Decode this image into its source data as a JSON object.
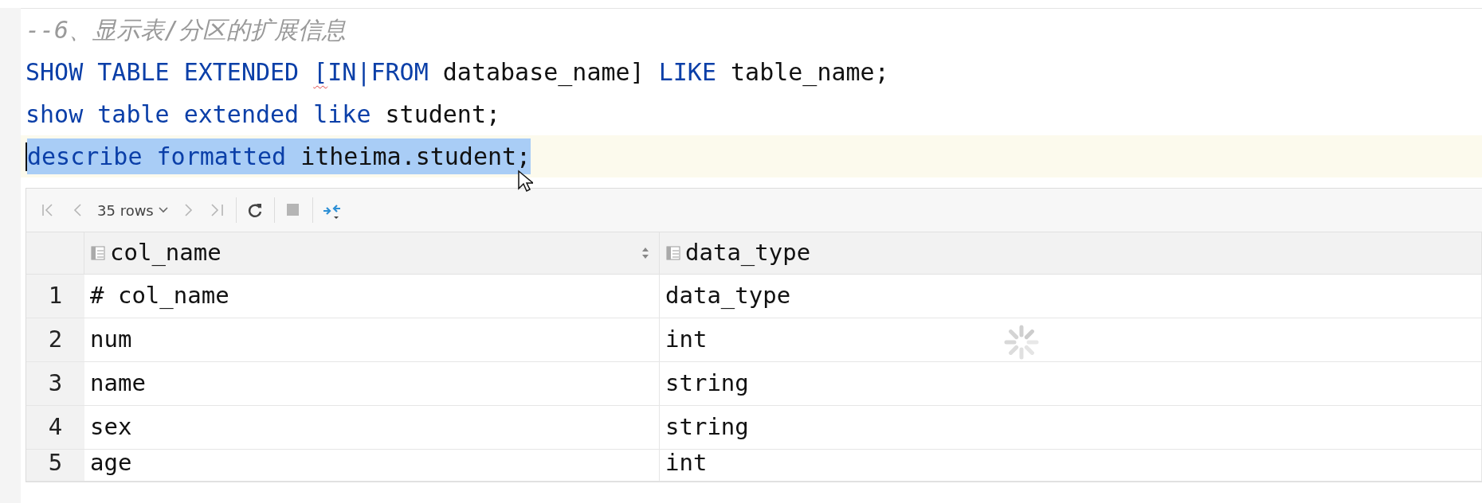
{
  "editor": {
    "lines": [
      {
        "selected": false,
        "caret": false,
        "tokens": [
          {
            "kind": "comment",
            "text": "--6、显示表/分区的扩展信息",
            "error": false
          }
        ]
      },
      {
        "selected": false,
        "caret": false,
        "tokens": [
          {
            "kind": "keyword",
            "text": "SHOW TABLE EXTENDED ",
            "error": false
          },
          {
            "kind": "keyword",
            "text": "[",
            "error": true
          },
          {
            "kind": "keyword",
            "text": "IN|FROM ",
            "error": false
          },
          {
            "kind": "plain",
            "text": "database_name] ",
            "error": false
          },
          {
            "kind": "keyword",
            "text": "LIKE ",
            "error": false
          },
          {
            "kind": "plain",
            "text": "table_name;",
            "error": false
          }
        ]
      },
      {
        "selected": false,
        "caret": false,
        "tokens": [
          {
            "kind": "keyword",
            "text": "show table extended like ",
            "error": false
          },
          {
            "kind": "plain",
            "text": "student;",
            "error": false
          }
        ]
      },
      {
        "selected": true,
        "caret": true,
        "tokens": [
          {
            "kind": "keyword",
            "text": "describe formatted ",
            "error": false
          },
          {
            "kind": "plain",
            "text": "itheima.student;",
            "error": false
          }
        ]
      }
    ]
  },
  "toolbar": {
    "buttons": [
      {
        "kind": "first",
        "disabled": true
      },
      {
        "kind": "prev",
        "disabled": true
      },
      {
        "kind": "rows",
        "text": "35 rows",
        "disabled": false
      },
      {
        "kind": "next",
        "disabled": true
      },
      {
        "kind": "last",
        "disabled": true
      },
      {
        "kind": "separator"
      },
      {
        "kind": "refresh",
        "disabled": false
      },
      {
        "kind": "separator"
      },
      {
        "kind": "stop",
        "disabled": true
      },
      {
        "kind": "separator"
      },
      {
        "kind": "compare",
        "disabled": false
      }
    ]
  },
  "grid": {
    "columns": [
      "col_name",
      "data_type"
    ],
    "loading": true,
    "rows": [
      {
        "number": "1",
        "cells": [
          "# col_name",
          "data_type"
        ]
      },
      {
        "number": "2",
        "cells": [
          "num",
          "int"
        ]
      },
      {
        "number": "3",
        "cells": [
          "name",
          "string"
        ]
      },
      {
        "number": "4",
        "cells": [
          "sex",
          "string"
        ]
      },
      {
        "number": "5",
        "cells": [
          "age",
          "int"
        ]
      }
    ]
  }
}
